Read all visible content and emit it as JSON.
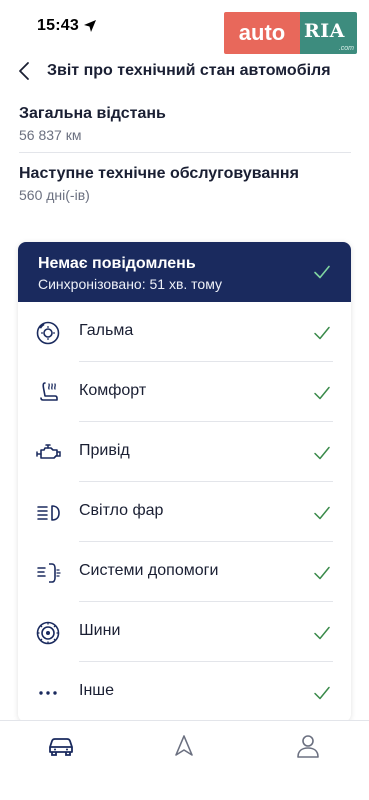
{
  "status_bar": {
    "time": "15:43"
  },
  "watermark": {
    "left": "auto",
    "right": "RIA",
    "suffix": ".com"
  },
  "header": {
    "title": "Звіт про технічний стан автомобіля"
  },
  "info": [
    {
      "label": "Загальна відстань",
      "value": "56 837 км"
    },
    {
      "label": "Наступне технічне обслуговування",
      "value": "560 дні(-ів)"
    }
  ],
  "status_card": {
    "title": "Немає повідомлень",
    "subtitle": "Синхронізовано: 51 хв. тому",
    "items": [
      {
        "label": "Гальма",
        "icon": "brake-disc-icon"
      },
      {
        "label": "Комфорт",
        "icon": "seat-icon"
      },
      {
        "label": "Привід",
        "icon": "engine-icon"
      },
      {
        "label": "Світло фар",
        "icon": "headlight-icon"
      },
      {
        "label": "Системи допомоги",
        "icon": "assist-system-icon"
      },
      {
        "label": "Шини",
        "icon": "tire-icon"
      },
      {
        "label": "Інше",
        "icon": "more-dots-icon"
      }
    ]
  },
  "tab_bar": {
    "tabs": [
      {
        "name": "car",
        "icon": "car-icon"
      },
      {
        "name": "navigation",
        "icon": "navigation-arrow-icon"
      },
      {
        "name": "profile",
        "icon": "user-icon"
      }
    ]
  },
  "colors": {
    "header_bg": "#1a2a5e",
    "check": "#3a8a4a",
    "text": "#1a1f33",
    "secondary_text": "#6b7080",
    "watermark_red": "#e8685b",
    "watermark_green": "#3d8c7e"
  }
}
